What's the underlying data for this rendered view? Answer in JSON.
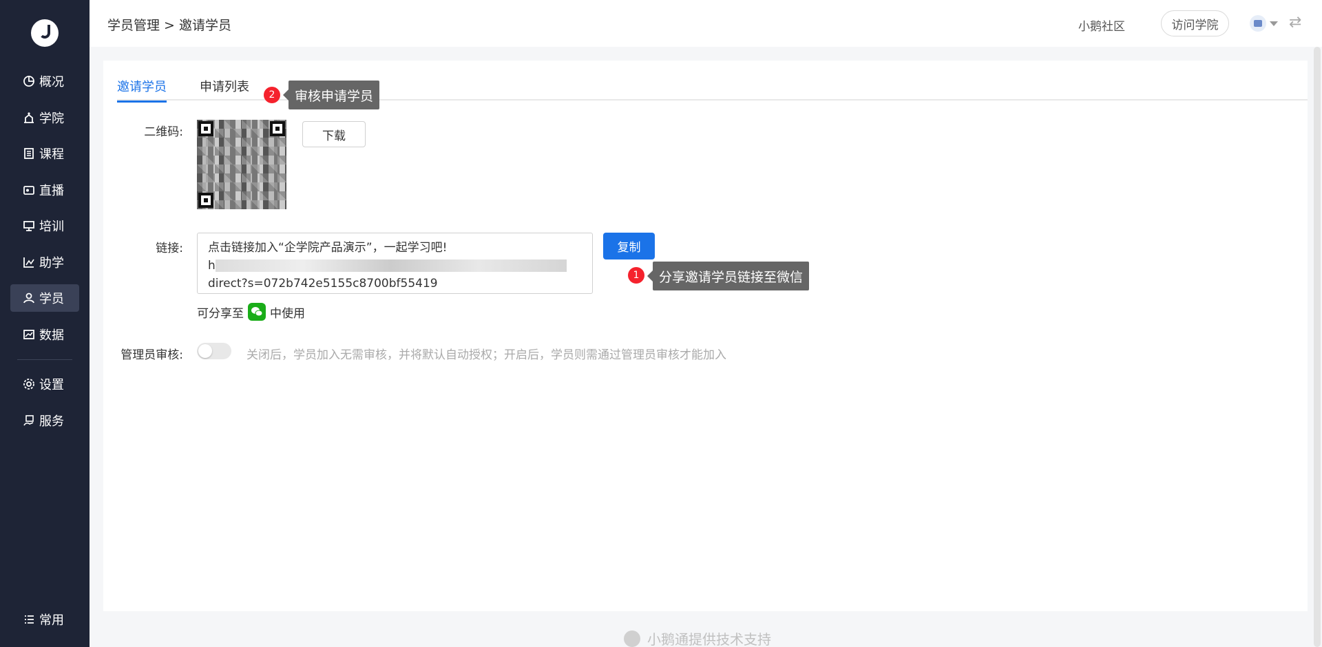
{
  "sidebar": {
    "items": [
      {
        "label": "概况",
        "icon": "pie-chart-icon"
      },
      {
        "label": "学院",
        "icon": "academy-icon"
      },
      {
        "label": "课程",
        "icon": "document-icon"
      },
      {
        "label": "直播",
        "icon": "live-icon"
      },
      {
        "label": "培训",
        "icon": "training-icon"
      },
      {
        "label": "助学",
        "icon": "bar-chart-icon"
      },
      {
        "label": "学员",
        "icon": "user-icon",
        "active": true
      },
      {
        "label": "数据",
        "icon": "data-icon"
      }
    ],
    "settings": [
      {
        "label": "设置",
        "icon": "gear-icon"
      },
      {
        "label": "服务",
        "icon": "service-icon"
      }
    ],
    "bottom": {
      "label": "常用",
      "icon": "list-icon"
    }
  },
  "header": {
    "breadcrumb": [
      "学员管理",
      ">",
      "邀请学员"
    ],
    "community": "小鹅社区",
    "visit_button": "访问学院"
  },
  "tabs": [
    {
      "label": "邀请学员",
      "active": true
    },
    {
      "label": "申请列表",
      "active": false
    }
  ],
  "annotations": [
    {
      "number": "2",
      "text": "审核申请学员"
    },
    {
      "number": "1",
      "text": "分享邀请学员链接至微信"
    }
  ],
  "form": {
    "qrcode_label": "二维码:",
    "download_button": "下载",
    "link_label": "链接:",
    "link_text_line1": "点击链接加入“企学院产品演示”，一起学习吧!",
    "link_text_line3": "direct?s=072b742e5155c8700bf55419",
    "copy_button": "复制",
    "share_prefix": "可分享至",
    "share_suffix": "中使用",
    "review_label": "管理员审核:",
    "review_desc": "关闭后，学员加入无需审核，并将默认自动授权；开启后，学员则需通过管理员审核才能加入"
  },
  "footer": {
    "text": "小鹅通提供技术支持"
  },
  "colors": {
    "sidebar": "#1e2436",
    "accent": "#1b73e8",
    "badge": "#f5222d",
    "tooltip": "#666666",
    "wechat": "#1aad19"
  }
}
